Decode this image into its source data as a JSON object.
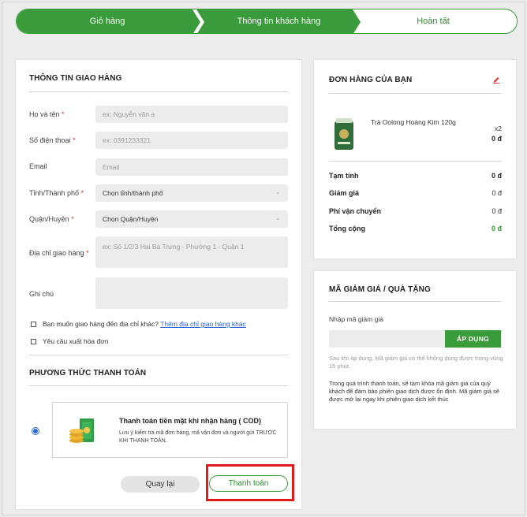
{
  "stepper": {
    "steps": [
      "Giỏ hàng",
      "Thông tin khách hàng",
      "Hoàn tất"
    ],
    "accent": "#3a9b3a"
  },
  "shipping": {
    "title": "THÔNG TIN GIAO HÀNG",
    "fields": {
      "name": {
        "label": "Họ và tên",
        "required": "*",
        "placeholder": "ex: Nguyễn văn a"
      },
      "phone": {
        "label": "Số điện thoại",
        "required": "*",
        "placeholder": "ex: 0391233321"
      },
      "email": {
        "label": "Email",
        "placeholder": "Email"
      },
      "province": {
        "label": "Tỉnh/Thành phố",
        "required": "*",
        "value": "Chọn tỉnh/thành phố"
      },
      "district": {
        "label": "Quận/Huyện",
        "required": "*",
        "value": "Chọn Quận/Huyện"
      },
      "address": {
        "label": "Địa chỉ giao hàng",
        "required": "*",
        "placeholder": "ex: Số 1/2/3 Hai Bà Trưng - Phường 1 - Quận 1"
      },
      "note": {
        "label": "Ghi chú",
        "placeholder": ""
      }
    },
    "other_address": {
      "label": "Bạn muốn giao hàng đến địa chỉ khác?",
      "link": "Thêm địa chỉ giao hàng khác"
    },
    "invoice": {
      "label": "Yêu cầu xuất hóa đơn"
    }
  },
  "payment": {
    "title": "PHƯƠNG THỨC THANH TOÁN",
    "method_title": "Thanh toán tiền mặt khi nhận hàng ( COD)",
    "method_desc": "Lưu ý kiểm tra mã đơn hàng, mã vận đơn và người gửi TRƯỚC KHI THANH TOÁN.",
    "back_label": "Quay lại",
    "pay_label": "Thanh toán"
  },
  "order": {
    "title": "ĐƠN HÀNG CỦA BẠN",
    "edit_icon": "pencil-icon",
    "product": {
      "name": "Trà Oolong Hoàng Kim 120g",
      "qty": "x2",
      "price": "0 đ"
    },
    "summary": [
      {
        "label": "Tạm tính",
        "value": "0 đ"
      },
      {
        "label": "Giảm giá",
        "value": "0 đ"
      },
      {
        "label": "Phí vận chuyển",
        "value": "0 đ"
      },
      {
        "label": "Tổng cộng",
        "value": "0 đ"
      }
    ]
  },
  "coupon": {
    "title": "MÃ GIẢM GIÁ / QUÀ TẶNG",
    "label": "Nhập mã giảm giá",
    "button": "ÁP DỤNG",
    "note": "Sau khi áp dụng, Mã giảm giá có thể không dùng được trong vòng 15 phút.",
    "info": "Trong quá trình thanh toán, sẽ tạm khóa mã giảm giá của quý khách để đảm bảo phiên giao dịch được ổn định. Mã giảm giá sẽ được mở lại ngay khi phiên giao dịch kết thúc"
  }
}
